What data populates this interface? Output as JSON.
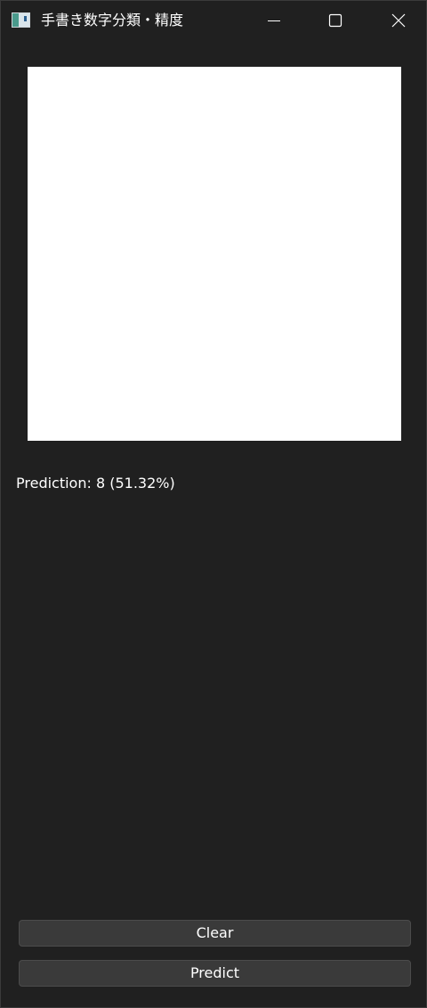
{
  "window": {
    "title": "手書き数字分類・精度",
    "icons": {
      "app": "app-window-icon",
      "minimize": "minimize-icon",
      "maximize": "maximize-icon",
      "close": "close-icon"
    }
  },
  "main": {
    "prediction_text": "Prediction: 8 (51.32%)"
  },
  "buttons": {
    "clear_label": "Clear",
    "predict_label": "Predict"
  },
  "colors": {
    "background": "#202020",
    "canvas": "#ffffff",
    "button": "#3a3a3a",
    "text": "#ffffff"
  }
}
